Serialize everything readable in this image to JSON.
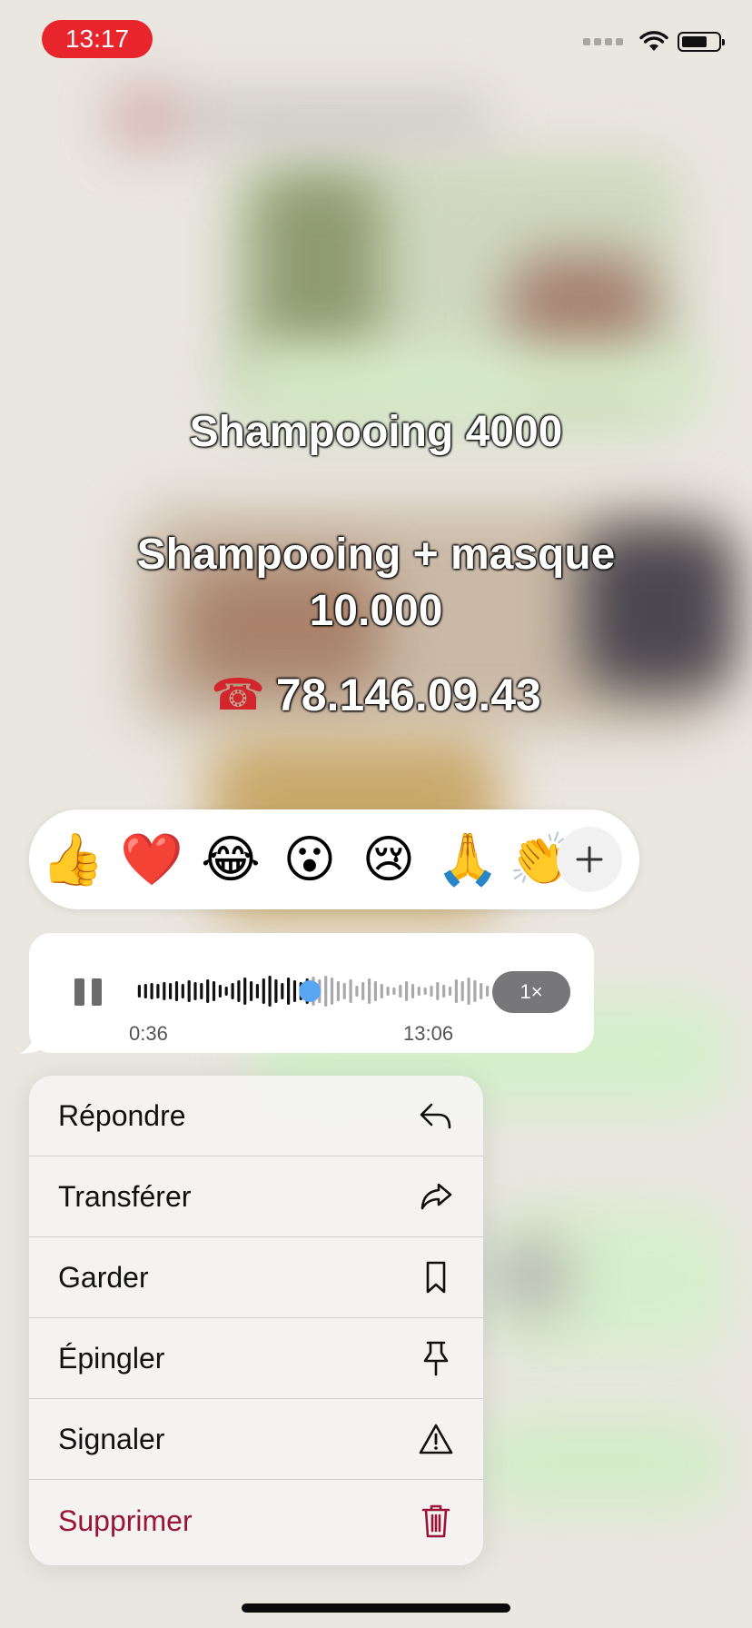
{
  "status_bar": {
    "time": "13:17"
  },
  "overlay": {
    "line1": "Shampooing 4000",
    "line2a": "Shampooing + masque",
    "line2b": "10.000",
    "phone_emoji": "☎",
    "phone_number": "78.146.09.43"
  },
  "reactions": [
    {
      "name": "thumbs-up",
      "glyph": "👍"
    },
    {
      "name": "red-heart",
      "glyph": "❤️"
    },
    {
      "name": "tears-of-joy",
      "glyph": "😂"
    },
    {
      "name": "surprised-face",
      "glyph": "😮"
    },
    {
      "name": "crying-face",
      "glyph": "😢"
    },
    {
      "name": "folded-hands",
      "glyph": "🙏"
    },
    {
      "name": "clapping-hands",
      "glyph": "👏"
    }
  ],
  "voice_message": {
    "elapsed": "0:36",
    "duration": "13:06",
    "speed": "1×",
    "progress": 0.49
  },
  "menu": {
    "items": [
      {
        "label": "Répondre",
        "icon": "reply-icon"
      },
      {
        "label": "Transférer",
        "icon": "forward-icon"
      },
      {
        "label": "Garder",
        "icon": "bookmark-icon"
      },
      {
        "label": "Épingler",
        "icon": "pin-icon"
      },
      {
        "label": "Signaler",
        "icon": "warning-icon"
      },
      {
        "label": "Supprimer",
        "icon": "trash-icon"
      }
    ]
  },
  "colors": {
    "time_pill": "#e8242c",
    "delete_red": "#9a1537",
    "waveform_played": "#111111",
    "waveform_unplayed": "#a9a9ab",
    "scrubber": "#59a7f2"
  }
}
